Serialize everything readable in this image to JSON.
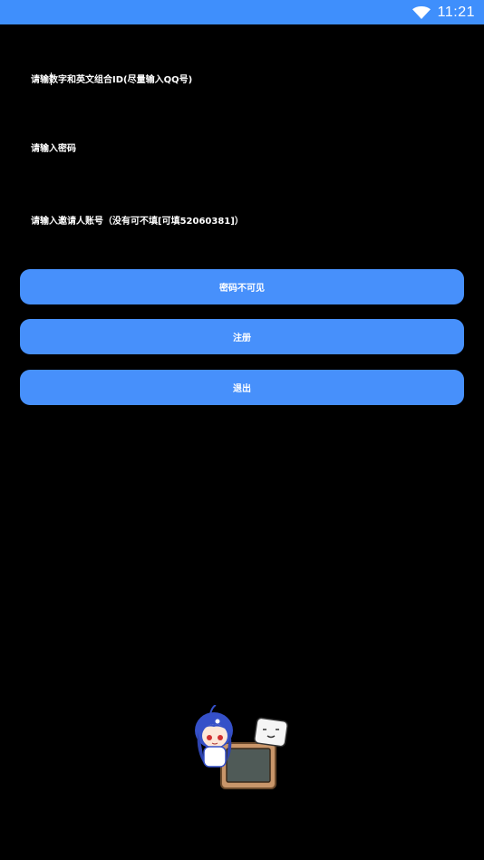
{
  "status_bar": {
    "time": "11:21",
    "wifi_icon": "wifi-icon"
  },
  "form": {
    "id_placeholder": "请输数字和英文组合ID(尽量输入QQ号)",
    "password_placeholder": "请输入密码",
    "inviter_placeholder": "请输入邀请人账号（没有可不填[可填52060381]）"
  },
  "buttons": {
    "toggle_password_label": "密码不可见",
    "register_label": "注册",
    "exit_label": "退出"
  },
  "colors": {
    "accent": "#4790fb",
    "status_bar": "#3f8ffc",
    "background": "#000000"
  }
}
